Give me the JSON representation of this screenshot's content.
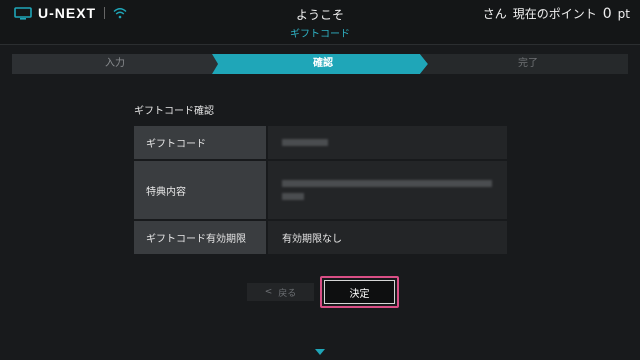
{
  "header": {
    "logo_text": "U-NEXT",
    "welcome": "ようこそ",
    "user_suffix": "さん",
    "points_label": "現在のポイント",
    "points_value": "0",
    "points_unit": "pt"
  },
  "page_title": "ギフトコード",
  "steps": [
    {
      "label": "入力",
      "state": "done"
    },
    {
      "label": "確認",
      "state": "active"
    },
    {
      "label": "完了",
      "state": "pending"
    }
  ],
  "section_title": "ギフトコード確認",
  "table": {
    "rows": [
      {
        "label": "ギフトコード",
        "value": ""
      },
      {
        "label": "特典内容",
        "value": ""
      },
      {
        "label": "ギフトコード有効期限",
        "value": "有効期限なし"
      }
    ]
  },
  "buttons": {
    "back_label": "戻る",
    "confirm_label": "決定"
  },
  "colors": {
    "accent": "#1fa6b8",
    "focus": "#d94f86",
    "background": "#181a1c"
  },
  "icons": {
    "tv": "tv-icon",
    "wifi": "wifi-icon",
    "back": "chevron-left-icon",
    "scroll": "chevron-down-icon"
  }
}
